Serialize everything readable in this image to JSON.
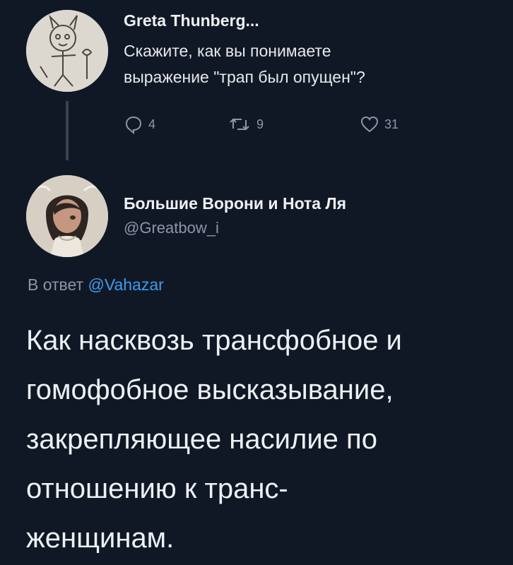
{
  "tweet1": {
    "author_name": "Greta Thunberg...",
    "text_lines": [
      "Скажите, как вы понимаете",
      "выражение \"трап был опущен\"?"
    ],
    "reply_count": "4",
    "retweet_count": "9",
    "like_count": "31"
  },
  "tweet2": {
    "author_name": "Большие Ворони и Нота Ля",
    "handle": "@Greatbow_i",
    "reply_to_prefix": "В ответ",
    "reply_to_mention": "@Vahazar",
    "text_lines": [
      "Как насквозь трансфобное и",
      "гомофобное высказывание,",
      "закрепляющее насилие по",
      "отношению к транс-",
      "женщинам."
    ]
  },
  "colors": {
    "background": "#111825",
    "muted": "#8a97a5",
    "mention": "#3d9bf0",
    "text": "#eef1f4"
  },
  "icons": {
    "reply": "reply-icon",
    "retweet": "retweet-icon",
    "like": "heart-icon"
  }
}
